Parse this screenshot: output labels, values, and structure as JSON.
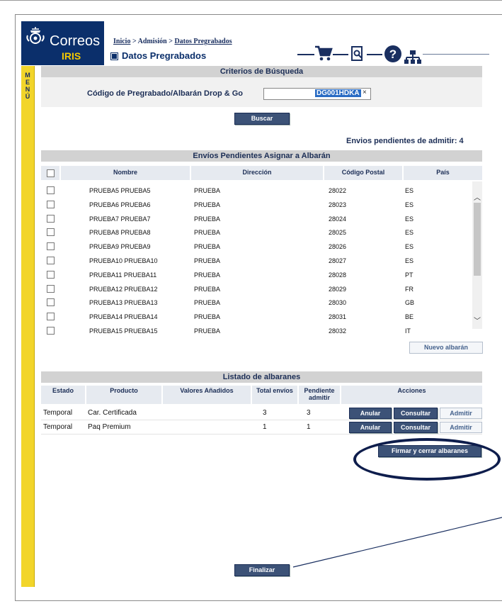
{
  "header": {
    "brand": "Correos",
    "subbrand": "IRIS",
    "breadcrumb": {
      "home": "Inicio",
      "sep1": " > ",
      "section": "Admisión",
      "sep2": " > ",
      "current": "Datos Pregrabados"
    },
    "title": "Datos Pregrabados",
    "icons": [
      "cart-icon",
      "document-search-icon",
      "help-icon",
      "sitemap-icon"
    ]
  },
  "side_menu": {
    "label": "MENÚ"
  },
  "search": {
    "section_title": "Criterios de Búsqueda",
    "field_label": "Código de Pregrabado/Albarán Drop & Go",
    "field_value": "DG001HDKA",
    "clear_glyph": "×",
    "search_button": "Buscar"
  },
  "pending_summary": "Envios pendientes de admitir: 4",
  "pending_table": {
    "title": "Envíos Pendientes Asignar a Albarán",
    "columns": [
      "Nombre",
      "Dirección",
      "Código Postal",
      "País"
    ],
    "rows": [
      {
        "nombre": "PRUEBA5 PRUEBA5",
        "direccion": "PRUEBA",
        "cp": "28022",
        "pais": "ES"
      },
      {
        "nombre": "PRUEBA6 PRUEBA6",
        "direccion": "PRUEBA",
        "cp": "28023",
        "pais": "ES"
      },
      {
        "nombre": "PRUEBA7 PRUEBA7",
        "direccion": "PRUEBA",
        "cp": "28024",
        "pais": "ES"
      },
      {
        "nombre": "PRUEBA8 PRUEBA8",
        "direccion": "PRUEBA",
        "cp": "28025",
        "pais": "ES"
      },
      {
        "nombre": "PRUEBA9 PRUEBA9",
        "direccion": "PRUEBA",
        "cp": "28026",
        "pais": "ES"
      },
      {
        "nombre": "PRUEBA10 PRUEBA10",
        "direccion": "PRUEBA",
        "cp": "28027",
        "pais": "ES"
      },
      {
        "nombre": "PRUEBA11 PRUEBA11",
        "direccion": "PRUEBA",
        "cp": "28028",
        "pais": "PT"
      },
      {
        "nombre": "PRUEBA12 PRUEBA12",
        "direccion": "PRUEBA",
        "cp": "28029",
        "pais": "FR"
      },
      {
        "nombre": "PRUEBA13 PRUEBA13",
        "direccion": "PRUEBA",
        "cp": "28030",
        "pais": "GB"
      },
      {
        "nombre": "PRUEBA14 PRUEBA14",
        "direccion": "PRUEBA",
        "cp": "28031",
        "pais": "BE"
      },
      {
        "nombre": "PRUEBA15 PRUEBA15",
        "direccion": "PRUEBA",
        "cp": "28032",
        "pais": "IT"
      }
    ],
    "new_button": "Nuevo albarán"
  },
  "albaranes": {
    "title": "Listado de albaranes",
    "columns": [
      "Estado",
      "Producto",
      "Valores Añadidos",
      "Total envíos",
      "Pendiente admitir",
      "Acciones"
    ],
    "rows": [
      {
        "estado": "Temporal",
        "producto": "Car. Certificada",
        "valores": "",
        "total": "3",
        "pendiente": "3"
      },
      {
        "estado": "Temporal",
        "producto": "Paq Premium",
        "valores": "",
        "total": "1",
        "pendiente": "1"
      }
    ],
    "actions": {
      "anular": "Anular",
      "consultar": "Consultar",
      "admitir": "Admitir"
    },
    "sign_button": "Firmar y cerrar albaranes"
  },
  "finish_button": "Finalizar"
}
